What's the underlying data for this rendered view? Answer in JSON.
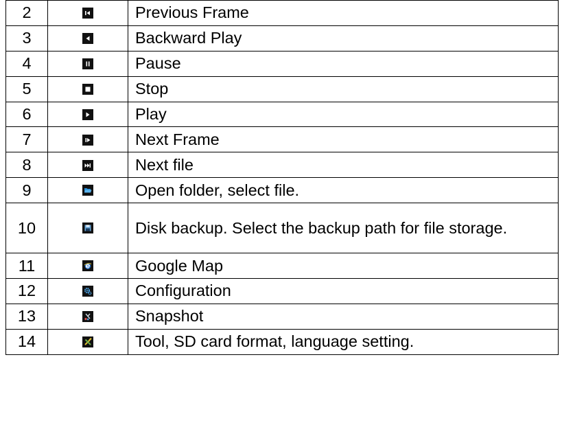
{
  "rows": [
    {
      "number": "2",
      "icon": "previous-frame-icon",
      "label": "Previous Frame"
    },
    {
      "number": "3",
      "icon": "backward-play-icon",
      "label": "Backward Play"
    },
    {
      "number": "4",
      "icon": "pause-icon",
      "label": "Pause"
    },
    {
      "number": "5",
      "icon": "stop-icon",
      "label": "Stop"
    },
    {
      "number": "6",
      "icon": "play-icon",
      "label": "Play"
    },
    {
      "number": "7",
      "icon": "next-frame-icon",
      "label": "Next Frame"
    },
    {
      "number": "8",
      "icon": "next-file-icon",
      "label": "Next file"
    },
    {
      "number": "9",
      "icon": "open-folder-icon",
      "label": "Open folder, select file."
    },
    {
      "number": "10",
      "icon": "disk-backup-icon",
      "label": "Disk backup. Select the backup path for file storage."
    },
    {
      "number": "11",
      "icon": "google-map-icon",
      "label": "Google Map"
    },
    {
      "number": "12",
      "icon": "configuration-icon",
      "label": "Configuration"
    },
    {
      "number": "13",
      "icon": "snapshot-icon",
      "label": "Snapshot"
    },
    {
      "number": "14",
      "icon": "tool-icon",
      "label": "Tool, SD card format, language setting."
    }
  ],
  "colors": {
    "icon_background": "#111111",
    "icon_glyph": "#ffffff",
    "folder_blue": "#2a8fd8",
    "disk_blue": "#6aa6d8",
    "map_blue": "#1f6fd0",
    "gear_blue": "#4aa0e0",
    "tool_yellow": "#e0c030"
  }
}
